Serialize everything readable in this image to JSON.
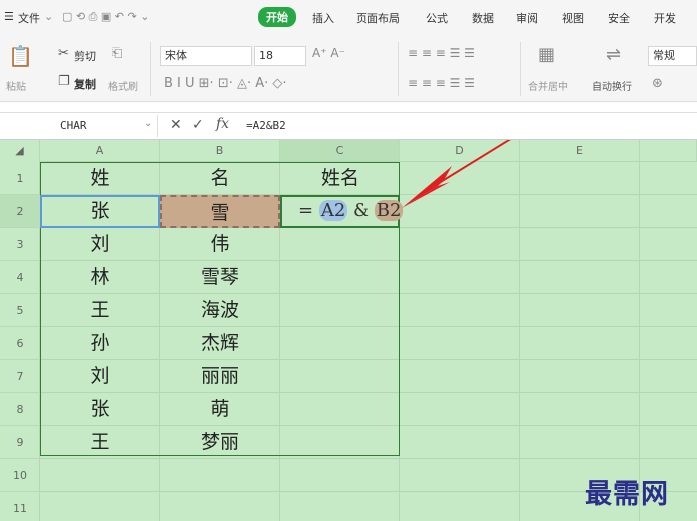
{
  "menubar": {
    "items": [
      "文件",
      "开始",
      "插入",
      "页面布局",
      "公式",
      "数据",
      "审阅",
      "视图",
      "安全",
      "开发"
    ],
    "active_index": 1,
    "active_color": "#28a745"
  },
  "ribbon": {
    "paste_label": "粘贴",
    "cut_label": "剪切",
    "copy_label": "复制",
    "format_painter_label": "格式刷",
    "font_name": "宋体",
    "font_size": "18",
    "merge_label": "合并居中",
    "wrap_label": "自动换行",
    "number_format": "常规"
  },
  "formula_bar": {
    "name_box": "CHAR",
    "fx_label": "fx",
    "formula": "=A2&B2"
  },
  "sheet": {
    "columns": [
      "A",
      "B",
      "C",
      "D",
      "E"
    ],
    "rows": [
      "1",
      "2",
      "3",
      "4",
      "5",
      "6",
      "7",
      "8",
      "9",
      "10",
      "11"
    ],
    "data": [
      [
        "姓",
        "名",
        "姓名"
      ],
      [
        "张",
        "雪",
        ""
      ],
      [
        "刘",
        "伟",
        ""
      ],
      [
        "林",
        "雪琴",
        ""
      ],
      [
        "王",
        "海波",
        ""
      ],
      [
        "孙",
        "杰辉",
        ""
      ],
      [
        "刘",
        "丽丽",
        ""
      ],
      [
        "张",
        "萌",
        ""
      ],
      [
        "王",
        "梦丽",
        ""
      ]
    ],
    "edit_formula": {
      "eq": "=",
      "ref1": "A2",
      "amp": "&",
      "ref2": "B2"
    },
    "ref1_color": "#9ec3e6",
    "ref2_color": "#c8a98c",
    "sheet_bg": "#c6e9c6"
  },
  "watermark": "最需网"
}
